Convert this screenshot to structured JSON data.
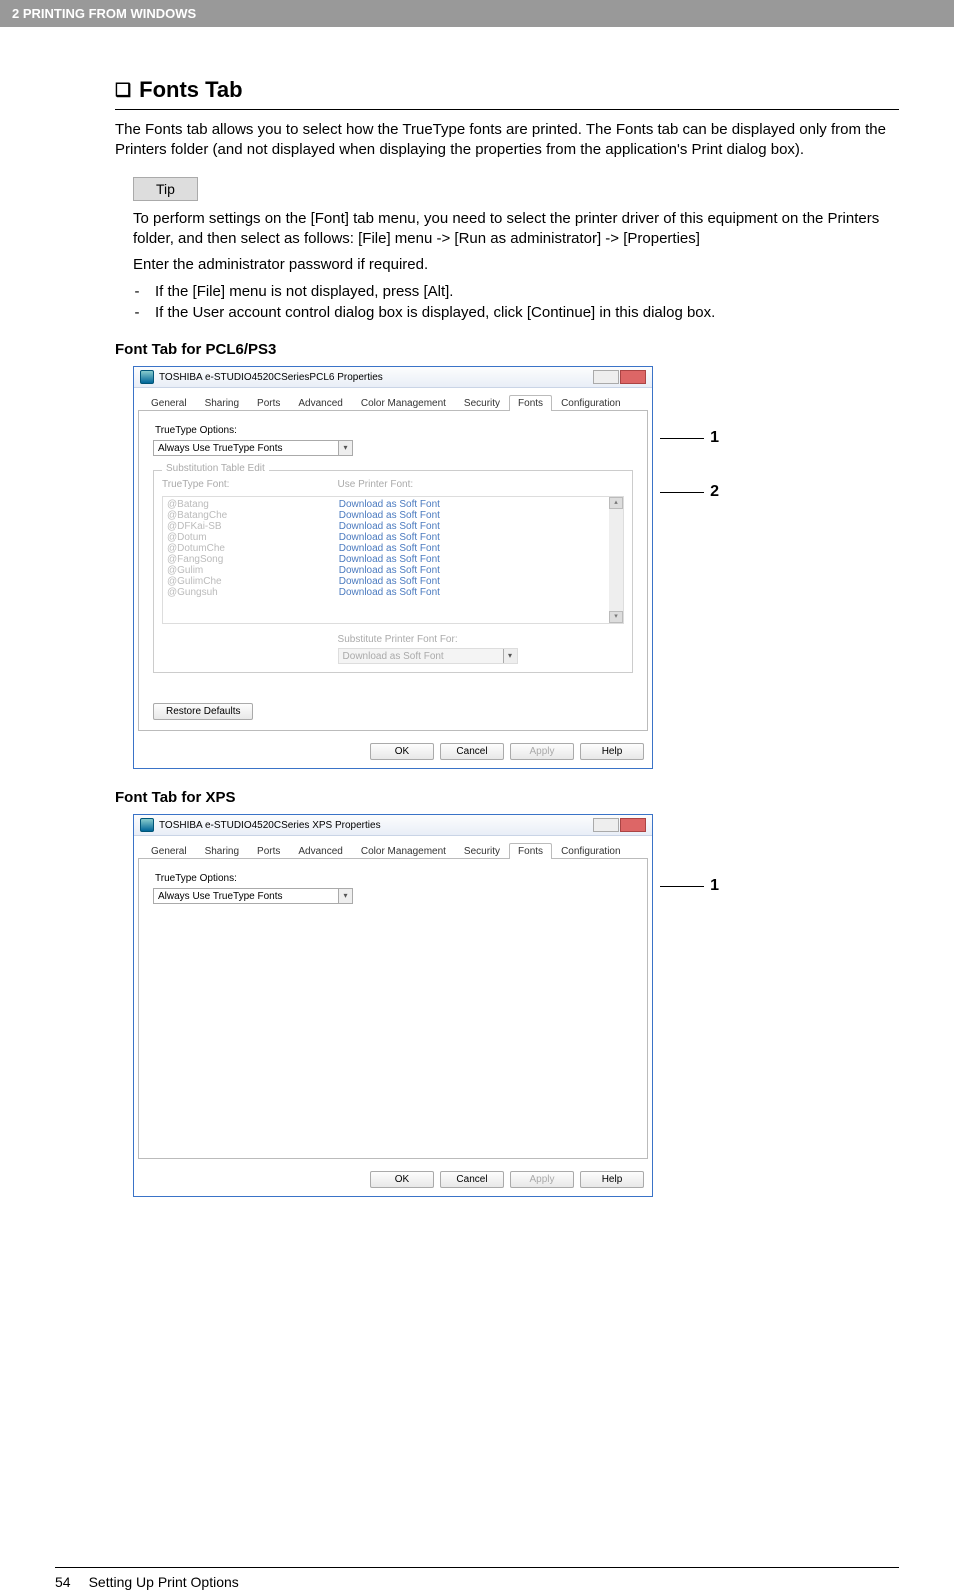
{
  "header": {
    "breadcrumb": "2 PRINTING FROM WINDOWS"
  },
  "section": {
    "title": "Fonts Tab",
    "intro": "The Fonts tab allows you to select how the TrueType fonts are printed.  The Fonts tab can be displayed only from the Printers folder (and not displayed when displaying the properties from the application's Print dialog box)."
  },
  "tip": {
    "label": "Tip",
    "line1": "To perform settings on the [Font] tab menu, you need to select the printer driver of this equipment on the Printers folder, and then select as follows: [File] menu -> [Run as administrator] -> [Properties]",
    "line2": "Enter the administrator password if required.",
    "bullets": [
      "If the [File] menu is not displayed, press [Alt].",
      "If the User account control dialog box is displayed, click [Continue] in this dialog box."
    ]
  },
  "subheadings": {
    "pcl": "Font Tab for PCL6/PS3",
    "xps": "Font Tab for XPS"
  },
  "dialog_common": {
    "tabs": [
      "General",
      "Sharing",
      "Ports",
      "Advanced",
      "Color Management",
      "Security",
      "Fonts",
      "Configuration"
    ],
    "active_tab": "Fonts",
    "tt_label": "TrueType Options:",
    "tt_value": "Always Use TrueType Fonts",
    "restore": "Restore Defaults",
    "ok": "OK",
    "cancel": "Cancel",
    "apply": "Apply",
    "help": "Help"
  },
  "dialog_pcl": {
    "title": "TOSHIBA e-STUDIO4520CSeriesPCL6 Properties",
    "sub_group_label": "Substitution Table Edit",
    "col_tt": "TrueType Font:",
    "col_use": "Use Printer Font:",
    "rows": [
      {
        "tt": "@Batang",
        "use": "Download as Soft Font"
      },
      {
        "tt": "@BatangChe",
        "use": "Download as Soft Font"
      },
      {
        "tt": "@DFKai-SB",
        "use": "Download as Soft Font"
      },
      {
        "tt": "@Dotum",
        "use": "Download as Soft Font"
      },
      {
        "tt": "@DotumChe",
        "use": "Download as Soft Font"
      },
      {
        "tt": "@FangSong",
        "use": "Download as Soft Font"
      },
      {
        "tt": "@Gulim",
        "use": "Download as Soft Font"
      },
      {
        "tt": "@GulimChe",
        "use": "Download as Soft Font"
      },
      {
        "tt": "@Gungsuh",
        "use": "Download as Soft Font"
      }
    ],
    "subst_label": "Substitute Printer Font For:",
    "subst_value": "Download as Soft Font",
    "callouts": {
      "one": "1",
      "two": "2"
    }
  },
  "dialog_xps": {
    "title": "TOSHIBA e-STUDIO4520CSeries XPS Properties",
    "callouts": {
      "one": "1"
    }
  },
  "footer": {
    "page": "54",
    "title": "Setting Up Print Options"
  }
}
